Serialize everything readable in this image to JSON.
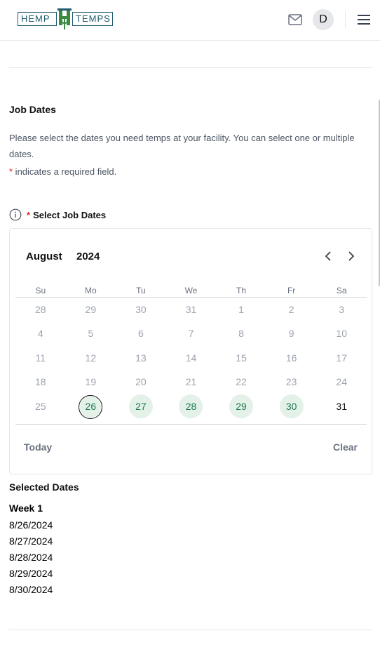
{
  "header": {
    "logo_left": "HEMP",
    "logo_right": "TEMPS",
    "avatar_initial": "D"
  },
  "job_dates": {
    "title": "Job Dates",
    "description": "Please select the dates you need temps at your facility. You can select one or multiple dates.",
    "required_symbol": "*",
    "required_note": " indicates a required field.",
    "field_label": "Select Job Dates"
  },
  "calendar": {
    "month": "August",
    "year": "2024",
    "weekdays": [
      "Su",
      "Mo",
      "Tu",
      "We",
      "Th",
      "Fr",
      "Sa"
    ],
    "weeks": [
      [
        "28",
        "29",
        "30",
        "31",
        "1",
        "2",
        "3"
      ],
      [
        "4",
        "5",
        "6",
        "7",
        "8",
        "9",
        "10"
      ],
      [
        "11",
        "12",
        "13",
        "14",
        "15",
        "16",
        "17"
      ],
      [
        "18",
        "19",
        "20",
        "21",
        "22",
        "23",
        "24"
      ],
      [
        "25",
        "26",
        "27",
        "28",
        "29",
        "30",
        "31"
      ]
    ],
    "selected_days": [
      "26",
      "27",
      "28",
      "29",
      "30"
    ],
    "current_day": "26",
    "today_label": "Today",
    "clear_label": "Clear",
    "accent_color": "#1e7a4f",
    "selected_bg": "#e3f1e9"
  },
  "selected": {
    "title": "Selected Dates",
    "week_label": "Week 1",
    "dates": [
      "8/26/2024",
      "8/27/2024",
      "8/28/2024",
      "8/29/2024",
      "8/30/2024"
    ]
  },
  "icons": {
    "mail": "mail-icon",
    "menu": "hamburger-menu-icon",
    "info": "info-icon",
    "prev": "chevron-left-icon",
    "next": "chevron-right-icon"
  }
}
